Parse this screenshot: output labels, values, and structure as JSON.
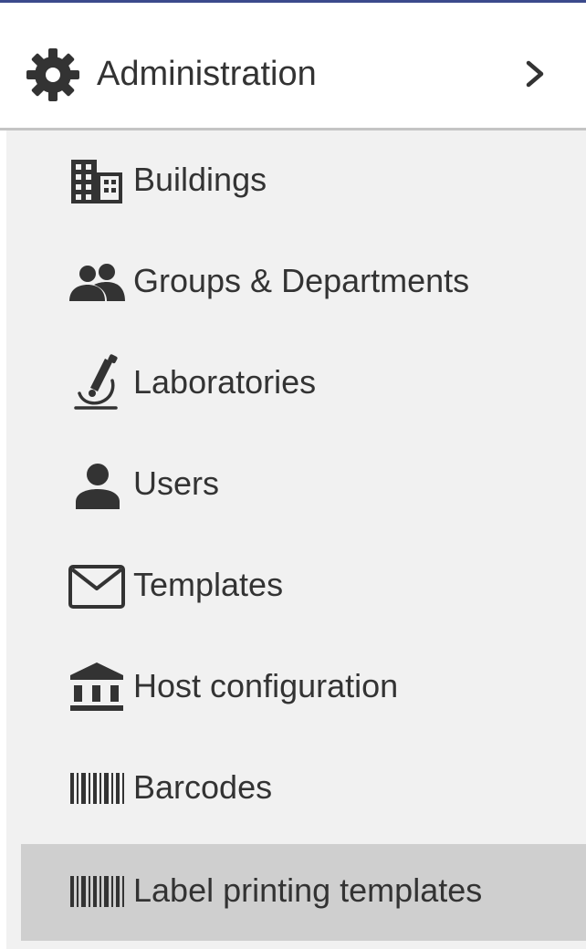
{
  "header": {
    "title": "Administration",
    "icon": "gear-icon",
    "expand_icon": "chevron-right-icon"
  },
  "submenu": {
    "items": [
      {
        "label": "Buildings",
        "icon": "building-icon",
        "active": false
      },
      {
        "label": "Groups & Departments",
        "icon": "people-icon",
        "active": false
      },
      {
        "label": "Laboratories",
        "icon": "microscope-icon",
        "active": false
      },
      {
        "label": "Users",
        "icon": "user-icon",
        "active": false
      },
      {
        "label": "Templates",
        "icon": "envelope-icon",
        "active": false
      },
      {
        "label": "Host configuration",
        "icon": "institution-icon",
        "active": false
      },
      {
        "label": "Barcodes",
        "icon": "barcode-icon",
        "active": false
      },
      {
        "label": "Label printing templates",
        "icon": "barcode-icon",
        "active": true
      }
    ]
  },
  "colors": {
    "top_border": "#3b4a8c",
    "submenu_bg": "#f1f1f1",
    "active_bg": "#cfcfcf",
    "text": "#333333"
  }
}
